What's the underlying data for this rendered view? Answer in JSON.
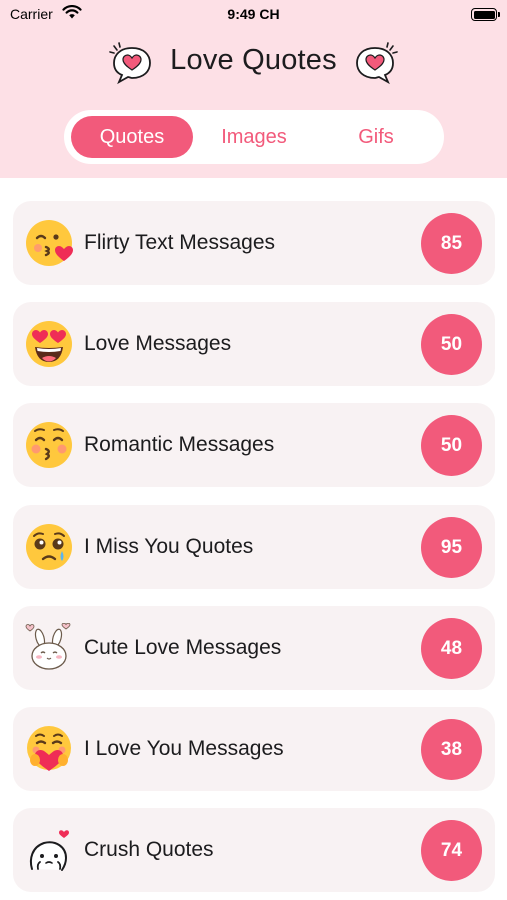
{
  "status_bar": {
    "carrier": "Carrier",
    "time": "9:49 CH",
    "battery_level": 1.0
  },
  "header": {
    "title": "Love Quotes"
  },
  "tabs": [
    {
      "label": "Quotes",
      "selected": true
    },
    {
      "label": "Images",
      "selected": false
    },
    {
      "label": "Gifs",
      "selected": false
    }
  ],
  "categories": [
    {
      "label": "Flirty Text Messages",
      "count": "85",
      "icon": "kissing-face-icon"
    },
    {
      "label": "Love Messages",
      "count": "50",
      "icon": "heart-eyes-face-icon"
    },
    {
      "label": "Romantic Messages",
      "count": "50",
      "icon": "kissing-closed-eyes-face-icon"
    },
    {
      "label": "I Miss You Quotes",
      "count": "95",
      "icon": "pleading-tear-face-icon"
    },
    {
      "label": "Cute Love Messages",
      "count": "48",
      "icon": "bunny-sticker-icon"
    },
    {
      "label": "I Love You Messages",
      "count": "38",
      "icon": "hugging-heart-face-icon"
    },
    {
      "label": "Crush Quotes",
      "count": "74",
      "icon": "shy-sticker-icon"
    }
  ],
  "colors": {
    "accent": "#f25a7b",
    "header_bg": "#fde0e6",
    "card_bg": "#f8f2f3"
  }
}
